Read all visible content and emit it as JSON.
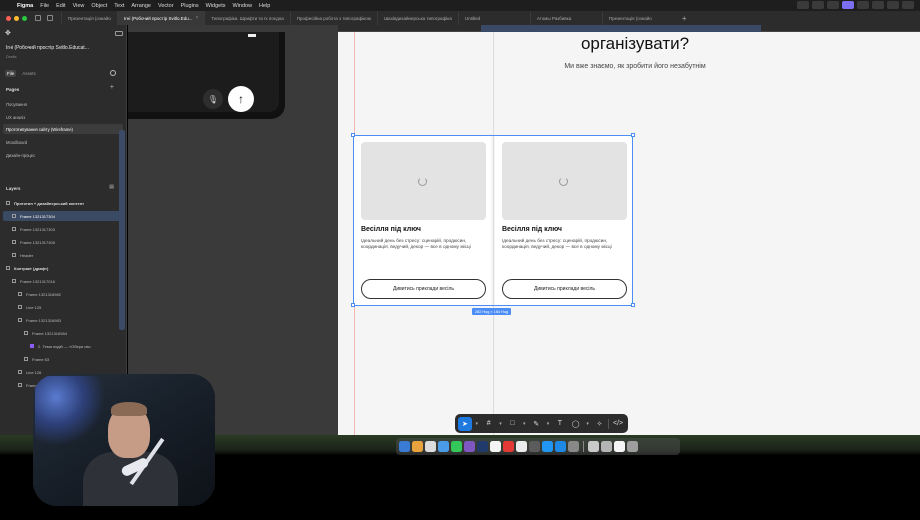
{
  "menubar": {
    "app": "Figma",
    "items": [
      "File",
      "Edit",
      "View",
      "Object",
      "Text",
      "Arrange",
      "Vector",
      "Plugins",
      "Widgets",
      "Window",
      "Help"
    ]
  },
  "tabs": [
    {
      "label": "Презентація (ознайо",
      "active": false
    },
    {
      "label": "Ігні (Робочий простір Svitlo.Edu...",
      "active": true
    },
    {
      "label": "Типографіка. Шрифти та їх поєдна",
      "active": false
    },
    {
      "label": "Професійна робота з типографікою",
      "active": false
    },
    {
      "label": "Шахівдизайнерська типографіка",
      "active": false
    },
    {
      "label": "Untitled",
      "active": false
    },
    {
      "label": "Атомы Разбивка",
      "active": false
    },
    {
      "label": "Презентація (ознайо",
      "active": false
    }
  ],
  "left_panel": {
    "project_name": "Ігні (Робочий простір Svitlo.Educat...",
    "project_sub": "Drafts",
    "file_tabs": [
      "File",
      "Assets"
    ],
    "pages_title": "Pages",
    "pages": [
      {
        "label": "Посування",
        "active": false
      },
      {
        "label": "UX аналіз",
        "active": false
      },
      {
        "label": "Прототипування сайту (Wireframe)",
        "active": true
      },
      {
        "label": "Moodboard",
        "active": false
      },
      {
        "label": "Дизайн-процес",
        "active": false
      }
    ],
    "layers_title": "Layers",
    "layers": [
      {
        "label": "Прототип + дизайнерський контент",
        "depth": 0,
        "bold": true,
        "selected": false,
        "icon": "section-icon"
      },
      {
        "label": "Frame 1321317304",
        "depth": 1,
        "bold": false,
        "selected": true,
        "icon": "frame-icon"
      },
      {
        "label": "Frame 1321317303",
        "depth": 1,
        "bold": false,
        "selected": false,
        "icon": "frame-icon"
      },
      {
        "label": "Frame 1321317305",
        "depth": 1,
        "bold": false,
        "selected": false,
        "icon": "frame-icon"
      },
      {
        "label": "Header",
        "depth": 1,
        "bold": false,
        "selected": false,
        "icon": "frame-icon"
      },
      {
        "label": "Контракт (драфт)",
        "depth": 0,
        "bold": true,
        "selected": false,
        "icon": "section-icon"
      },
      {
        "label": "Frame 1321317016",
        "depth": 1,
        "bold": false,
        "selected": false,
        "icon": "frame-icon"
      },
      {
        "label": "Frame 1321316982",
        "depth": 2,
        "bold": false,
        "selected": false,
        "icon": "frame-icon"
      },
      {
        "label": "Line 125",
        "depth": 2,
        "bold": false,
        "selected": false,
        "icon": "line-icon"
      },
      {
        "label": "Frame 1321316983",
        "depth": 2,
        "bold": false,
        "selected": false,
        "icon": "frame-icon"
      },
      {
        "label": "Frame 1321316984",
        "depth": 3,
        "bold": false,
        "selected": false,
        "icon": "frame-icon"
      },
      {
        "label": "2. Тема подій — «Обери сво",
        "depth": 4,
        "bold": false,
        "selected": false,
        "icon": "component-icon"
      },
      {
        "label": "Frame 63",
        "depth": 3,
        "bold": false,
        "selected": false,
        "icon": "frame-icon"
      },
      {
        "label": "Line 126",
        "depth": 2,
        "bold": false,
        "selected": false,
        "icon": "line-icon"
      },
      {
        "label": "Frame 13",
        "depth": 2,
        "bold": false,
        "selected": false,
        "icon": "frame-icon"
      }
    ]
  },
  "canvas": {
    "heading": "організувати?",
    "subheading": "Ми вже знаємо, як зробити його незабутнім",
    "cards": [
      {
        "title": "Весілля під ключ",
        "description": "Ідеальний день без стресу: сценарій, продюсин, координація, ведучий, декор — все в одному місці",
        "button": "Дивитись приклади весіль"
      },
      {
        "title": "Весілля під ключ",
        "description": "Ідеальний день без стресу: сценарій, продюсин, координація, ведучий, декор — все в одному місці",
        "button": "Дивитись приклади весіль"
      }
    ],
    "size_badge": "282 Hug × 184 Hug"
  },
  "toolbar": {
    "tools": [
      "move-tool",
      "frame-tool",
      "shape-tool",
      "pen-tool",
      "text-tool",
      "comment-tool",
      "actions-tool",
      "dev-mode-tool"
    ],
    "active": "move-tool"
  },
  "colors": {
    "selection": "#4c8ef7",
    "active_tool": "#1f7ae0",
    "panel_bg": "#2c2c2c",
    "canvas_light": "#f5f5f5"
  }
}
